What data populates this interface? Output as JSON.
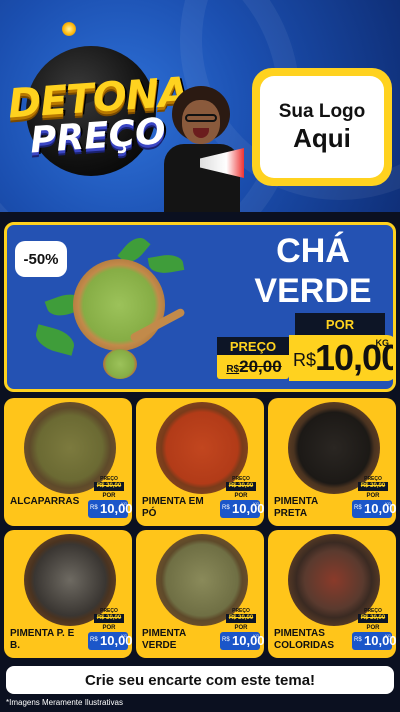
{
  "header": {
    "brand_line1": "DETONA",
    "brand_line2": "PREÇO",
    "logo_line1": "Sua Logo",
    "logo_line2": "Aqui"
  },
  "hero": {
    "discount": "-50%",
    "name_line1": "CHÁ",
    "name_line2": "VERDE",
    "por_label": "POR",
    "preco_label": "PREÇO",
    "old_currency": "R$",
    "old_price": "20,00",
    "currency": "R$",
    "price": "10,00",
    "unit": "KG"
  },
  "products": [
    {
      "name": "ALCAPARRAS",
      "preco_label": "PREÇO",
      "old_price": "R$ 20,00",
      "por_label": "POR",
      "currency": "R$",
      "price": "10,00",
      "unit": "KG"
    },
    {
      "name": "PIMENTA EM PÓ",
      "preco_label": "PREÇO",
      "old_price": "R$ 20,00",
      "por_label": "POR",
      "currency": "R$",
      "price": "10,00",
      "unit": "KG"
    },
    {
      "name": "PIMENTA PRETA",
      "preco_label": "PREÇO",
      "old_price": "R$ 20,00",
      "por_label": "POR",
      "currency": "R$",
      "price": "10,00",
      "unit": "KG"
    },
    {
      "name": "PIMENTA P. E B.",
      "preco_label": "PREÇO",
      "old_price": "R$ 20,00",
      "por_label": "POR",
      "currency": "R$",
      "price": "10,00",
      "unit": "KG"
    },
    {
      "name": "PIMENTA VERDE",
      "preco_label": "PREÇO",
      "old_price": "R$ 20,00",
      "por_label": "POR",
      "currency": "R$",
      "price": "10,00",
      "unit": "KG"
    },
    {
      "name": "PIMENTAS COLORIDAS",
      "preco_label": "PREÇO",
      "old_price": "R$ 20,00",
      "por_label": "POR",
      "currency": "R$",
      "price": "10,00",
      "unit": "KG"
    }
  ],
  "cta": {
    "label": "Crie seu encarte com este tema!"
  },
  "footnote": "*Imagens Meramente Ilustrativas",
  "colors": {
    "accent_yellow": "#ffd21f",
    "primary_blue": "#2452b3",
    "dark": "#0d1526",
    "price_blue": "#1b56c9"
  }
}
